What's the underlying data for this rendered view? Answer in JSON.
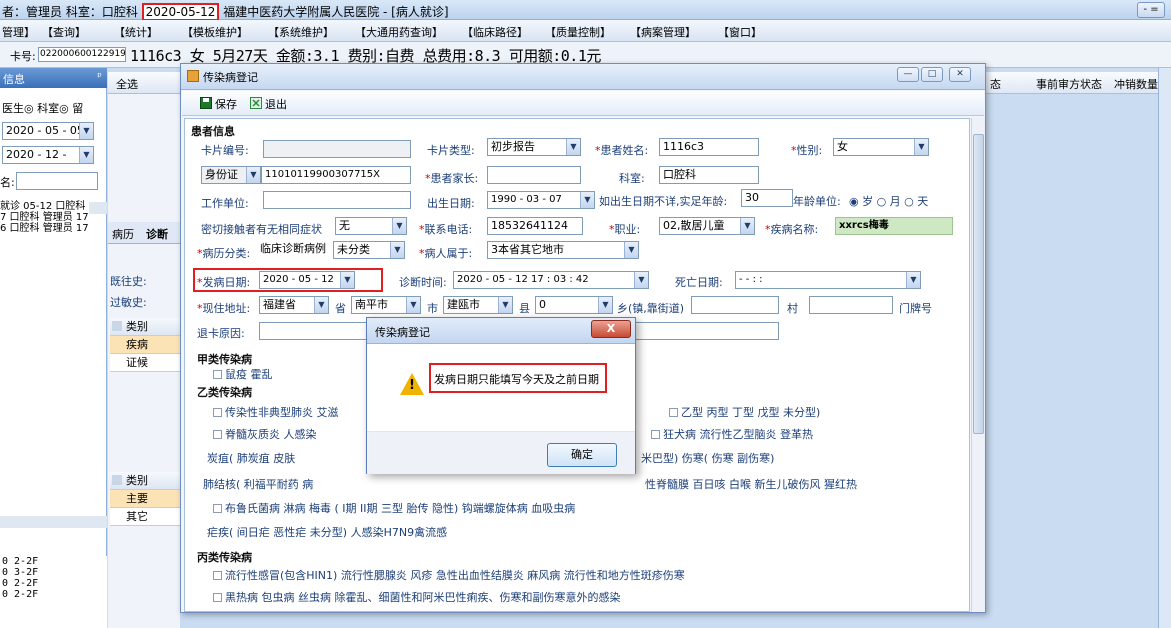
{
  "titlebar": {
    "prefix": "者：管理员 科室：口腔科 ",
    "date": "2020-05-12",
    "suffix": " 福建中医药大学附属人民医院 - [病人就诊]",
    "min_btn": "- ="
  },
  "menu": [
    "管理】",
    "【查询】",
    "【统计】",
    "【模板维护】",
    "【系统维护】",
    "【大通用药查询】",
    "【临床路径】",
    "【质量控制】",
    "【病案管理】",
    "【窗口】"
  ],
  "infobar": {
    "card_label": "卡号:",
    "card_no": "022000600122919",
    "text": "1116c3 女 5月27天 金额:3.1 费别:自费 总费用:8.3 可用额:0.1元"
  },
  "left": {
    "header": "信息",
    "pin": "ᵖ",
    "radio_text": "医生◎ 科室◎ 留",
    "date1": "2020 - 05 - 05",
    "date2": "2020 - 12 -",
    "name_label": "名:",
    "list": [
      "就诊 05-12 口腔科",
      "7 口腔科 管理员 17",
      "6 口腔科 管理员 17"
    ],
    "bottom": [
      "0 2-2F",
      "0 3-2F",
      "0 2-2F",
      "0 2-2F"
    ]
  },
  "grid_header": {
    "select_all": "全选",
    "col1": "态",
    "col2": "事前审方状态",
    "col3": "冲销数量"
  },
  "mid": {
    "tabs": [
      "病历",
      "诊断"
    ],
    "past_label": "既往史:",
    "allergy_label": "过敏史:",
    "cat1": [
      "类别",
      "疾病",
      "证候"
    ],
    "cat2": [
      "类别",
      "主要",
      "其它"
    ]
  },
  "window": {
    "title": "传染病登记",
    "save": "保存",
    "exit": "退出",
    "section_patient": "患者信息",
    "card_no_label": "卡片编号:",
    "card_type_label": "卡片类型:",
    "card_type": "初步报告",
    "patient_name_label": "患者姓名:",
    "patient_name": "1116c3",
    "sex_label": "性别:",
    "sex": "女",
    "id_type": "身份证",
    "id_no": "11010119900307715X",
    "guardian_label": "患者家长:",
    "dept_label": "科室:",
    "dept": "口腔科",
    "work_label": "工作单位:",
    "birth_label": "出生日期:",
    "birth": "1990 - 03 - 07",
    "birth_unknown_label": "如出生日期不详,实足年龄:",
    "age": "30",
    "age_unit_label": "年龄单位:",
    "age_unit": "◉ 岁 ○ 月 ○ 天",
    "contact_label": "密切接触者有无相同症状",
    "contact": "无",
    "phone_label": "联系电话:",
    "phone": "18532641124",
    "job_label": "职业:",
    "job": "02,散居儿童",
    "disease_label": "疾病名称:",
    "disease": "xxrcs梅毒",
    "case_class_label": "病历分类:",
    "case_class": "临床诊断病例",
    "case_class2": "未分类",
    "belong_label": "病人属于:",
    "belong": "3本省其它地市",
    "onset_label": "发病日期:",
    "onset": "2020 - 05 - 12",
    "diag_time_label": "诊断时间:",
    "diag_time": "2020 - 05 - 12   17 : 03 : 42",
    "death_label": "死亡日期:",
    "death": "-    -        :    :",
    "address_label": "现住地址:",
    "province": "福建省",
    "province_suffix": "省",
    "city": "南平市",
    "city_suffix": "市",
    "county": "建瓯市",
    "county_suffix": "县",
    "town_value": "0",
    "town_label": "乡(镇,靠街道)",
    "village_label": "村",
    "house_label": "门牌号",
    "return_label": "退卡原因:",
    "class_a": "甲类传染病",
    "class_a_items": "鼠疫    霍乱",
    "class_b": "乙类传染病",
    "class_b_l1": "传染性非典型肺炎   艾滋",
    "class_b_l1r": "乙型    丙型    丁型    戊型    未分型)",
    "class_b_l2": "脊髓灰质炎    人感染",
    "class_b_l2r": "狂犬病    流行性乙型脑炎    登革热",
    "class_b_l3": "炭疽(    肺炭疽    皮肤",
    "class_b_l3r": "米巴型)    伤寒(    伤寒    副伤寒)",
    "class_b_l4": "肺结核(   利福平耐药    病",
    "class_b_l4r": "性脊髓膜    百日咳    白喉    新生儿破伤风    猩红热",
    "class_b_l5": "布鲁氏菌病         淋病         梅毒 (   I期    II期    三型    胎传    隐性)    钩端螺旋体病       血吸虫病",
    "class_b_l6": "疟疾(    间日疟    恶性疟    未分型)    人感染H7N9禽流感",
    "class_c": "丙类传染病",
    "class_c_l1": "流行性感冒(包含HIN1)    流行性腮腺炎    风疹         急性出血性结膜炎     麻风病     流行性和地方性斑疹伤寒",
    "class_c_l2": "黑热病              包虫病                丝虫病               除霍乱、细菌性和阿米巴性痢疾、伤寒和副伤寒意外的感染"
  },
  "dialog": {
    "title": "传染病登记",
    "close": "X",
    "warn_mark": "!",
    "message": "发病日期只能填写今天及之前日期",
    "ok": "确定"
  },
  "colors": {
    "highlight": "#e02020",
    "warning": "#f0b400",
    "title_blue": "#3b6fb8"
  }
}
